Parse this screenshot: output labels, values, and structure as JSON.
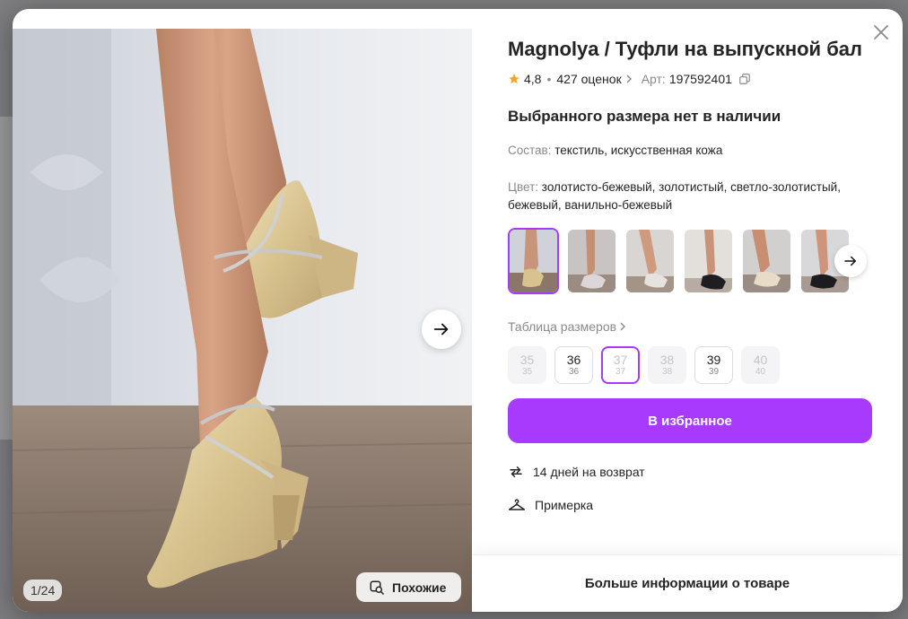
{
  "product": {
    "title": "Magnolya / Туфли на выпускной бал",
    "rating": "4,8",
    "reviews": "427 оценок",
    "article_label": "Арт:",
    "article": "197592401",
    "stock_status": "Выбранного размера нет в наличии",
    "composition_label": "Состав:",
    "composition": "текстиль, искусственная кожа",
    "color_label": "Цвет:",
    "color": "золотисто-бежевый, золотистый, светло-золотистый, бежевый, ванильно-бежевый"
  },
  "gallery": {
    "counter": "1/24",
    "similar_label": "Похожие"
  },
  "size_table_label": "Таблица размеров",
  "sizes": [
    {
      "n": "35",
      "s": "35",
      "state": "disabled"
    },
    {
      "n": "36",
      "s": "36",
      "state": "available"
    },
    {
      "n": "37",
      "s": "37",
      "state": "selected-unavailable"
    },
    {
      "n": "38",
      "s": "38",
      "state": "disabled"
    },
    {
      "n": "39",
      "s": "39",
      "state": "available"
    },
    {
      "n": "40",
      "s": "40",
      "state": "disabled"
    }
  ],
  "actions": {
    "favorite_label": "В избранное",
    "more_info_label": "Больше информации о товаре"
  },
  "features": {
    "returns": "14 дней на возврат",
    "fitting": "Примерка"
  },
  "colors": {
    "accent": "#a73afd",
    "text": "#242424",
    "muted": "#8a8a8e",
    "star": "#f4a623"
  }
}
